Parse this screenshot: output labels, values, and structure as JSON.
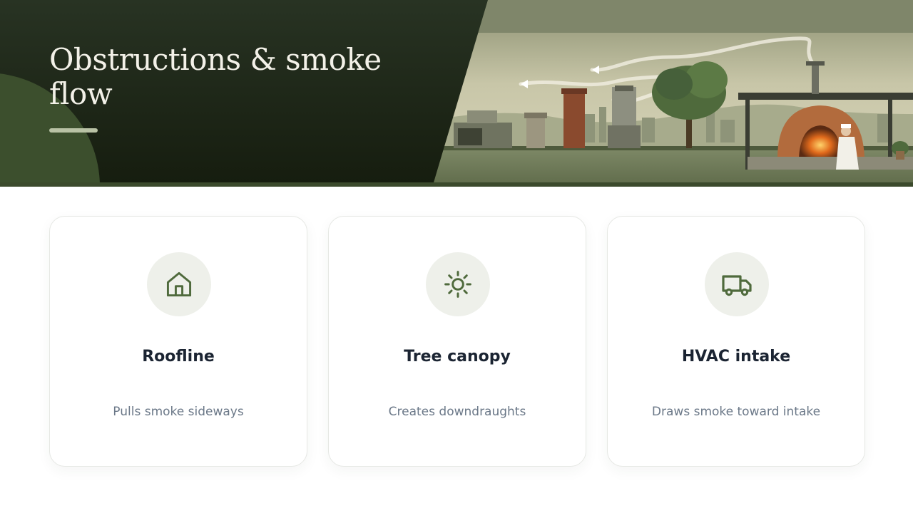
{
  "colors": {
    "hero_dark": "#1f2817",
    "accent_green": "#4f6a3c",
    "icon_badge_bg": "#eef0ea",
    "title_text": "#1b2432",
    "desc_text": "#6b7888"
  },
  "hero": {
    "title": "Obstructions & smoke flow"
  },
  "cards": [
    {
      "icon": "house-icon",
      "title": "Roofline",
      "description": "Pulls smoke sideways"
    },
    {
      "icon": "sun-icon",
      "title": "Tree canopy",
      "description": "Creates downdraughts"
    },
    {
      "icon": "truck-icon",
      "title": "HVAC intake",
      "description": "Draws smoke toward intake"
    }
  ]
}
